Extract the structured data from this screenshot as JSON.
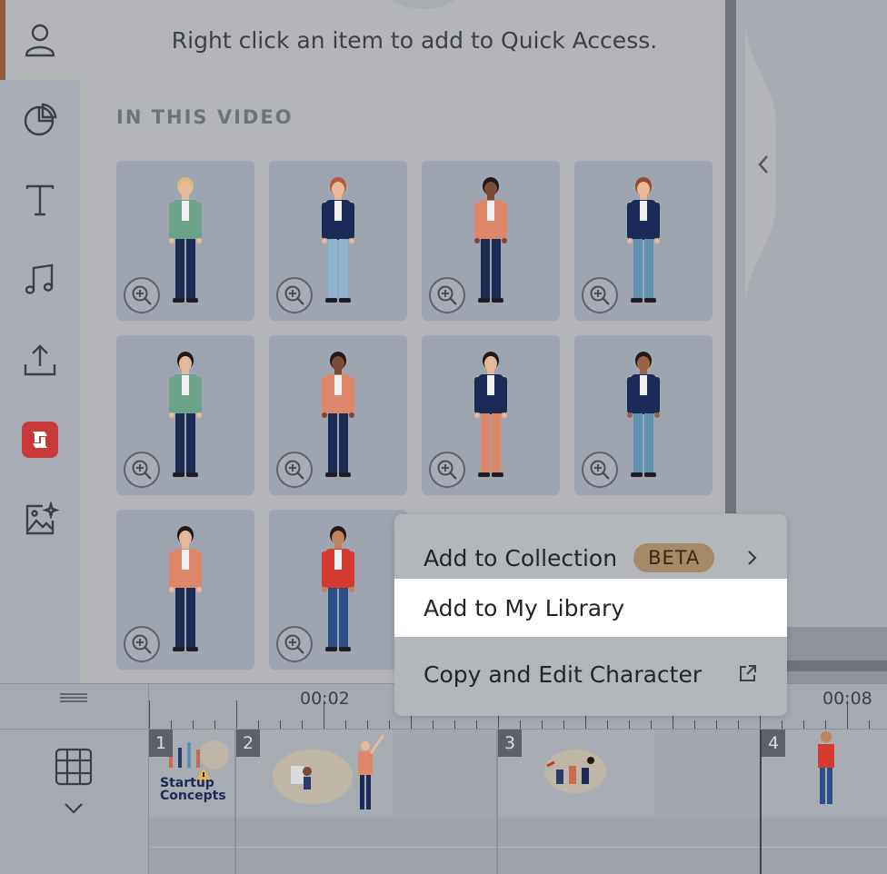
{
  "panel": {
    "tip": "Right click an item to add to Quick Access.",
    "section_title": "IN THIS VIDEO"
  },
  "rail": {
    "items": [
      {
        "name": "character-icon",
        "active": true
      },
      {
        "name": "chart-icon"
      },
      {
        "name": "text-icon"
      },
      {
        "name": "music-icon"
      },
      {
        "name": "upload-icon"
      },
      {
        "name": "brand-icon"
      },
      {
        "name": "ai-image-icon"
      }
    ]
  },
  "characters": [
    {
      "name": "character-1",
      "hair": "#d8b97a",
      "skin": "#e8b89a",
      "top": "#6aa38a",
      "pants": "#1c2b55"
    },
    {
      "name": "character-2",
      "hair": "#b55a3a",
      "skin": "#e8b89a",
      "top": "#1c2b55",
      "pants": "#8fb4d0"
    },
    {
      "name": "character-3",
      "hair": "#1f1a17",
      "skin": "#7a4a33",
      "top": "#e0866a",
      "pants": "#1c2b55"
    },
    {
      "name": "character-4",
      "hair": "#9a4b2d",
      "skin": "#e8b89a",
      "top": "#1c2b55",
      "pants": "#5f92b0"
    },
    {
      "name": "character-5",
      "hair": "#1f1a17",
      "skin": "#e8b89a",
      "top": "#6aa38a",
      "pants": "#1c2b55"
    },
    {
      "name": "character-6",
      "hair": "#1f1a17",
      "skin": "#7a4a33",
      "top": "#e0866a",
      "pants": "#1c2b55"
    },
    {
      "name": "character-7",
      "hair": "#1f1a17",
      "skin": "#e8b89a",
      "top": "#1c2b55",
      "pants": "#e0866a"
    },
    {
      "name": "character-8",
      "hair": "#1f1a17",
      "skin": "#9a6346",
      "top": "#1c2b55",
      "pants": "#5f92b0"
    },
    {
      "name": "character-9",
      "hair": "#1f1a17",
      "skin": "#e8b89a",
      "top": "#e0866a",
      "pants": "#1c2b55"
    },
    {
      "name": "character-10",
      "hair": "#1f1a17",
      "skin": "#c0835e",
      "top": "#d43a2f",
      "pants": "#2a4f8a"
    }
  ],
  "timeline": {
    "time_labels": [
      "00:02",
      "00:08"
    ],
    "scenes": [
      {
        "number": "1",
        "caption_line1": "Startup",
        "caption_line2": "Concepts"
      },
      {
        "number": "2"
      },
      {
        "number": "3"
      },
      {
        "number": "4"
      }
    ]
  },
  "context_menu": {
    "items": [
      {
        "label": "Add to Collection",
        "badge": "BETA",
        "has_submenu": true
      },
      {
        "label": "Add to My Library",
        "highlighted": true
      },
      {
        "label": "Copy and Edit Character",
        "external": true
      }
    ]
  },
  "colors": {
    "overlay_bg": "#b3b5b8",
    "card_bg": "#9fa5b0",
    "active_accent": "#8e5b3e",
    "brand_red": "#c83a3a",
    "beta_badge": "#a58a68"
  }
}
